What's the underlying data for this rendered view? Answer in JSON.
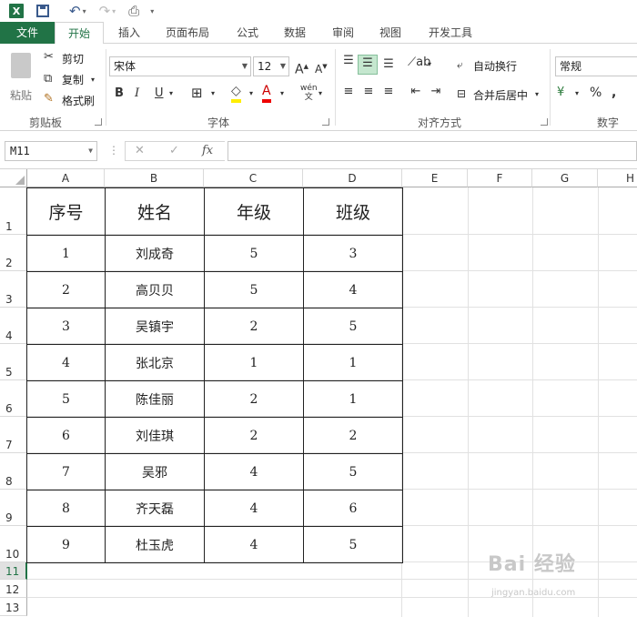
{
  "qat": {
    "excel_logo": "X",
    "icons": [
      "excel-icon",
      "save-icon",
      "undo-icon",
      "redo-icon",
      "print-preview-icon",
      "customize-icon"
    ]
  },
  "tabs": [
    "文件",
    "开始",
    "插入",
    "页面布局",
    "公式",
    "数据",
    "审阅",
    "视图",
    "开发工具"
  ],
  "ribbon": {
    "clipboard": {
      "paste": "粘贴",
      "cut": "剪切",
      "copy": "复制",
      "format_painter": "格式刷",
      "label": "剪贴板"
    },
    "font": {
      "name": "宋体",
      "size": "12",
      "bold": "B",
      "italic": "I",
      "underline": "U",
      "label": "字体"
    },
    "alignment": {
      "wrap": "自动换行",
      "merge": "合并后居中",
      "label": "对齐方式"
    },
    "number": {
      "format": "常规",
      "label": "数字"
    }
  },
  "formula_bar": {
    "name_box": "M11",
    "cancel": "✕",
    "enter": "✓",
    "fx": "fx",
    "value": ""
  },
  "columns": [
    "A",
    "B",
    "C",
    "D",
    "E",
    "F",
    "G",
    "H"
  ],
  "rows": [
    "1",
    "2",
    "3",
    "4",
    "5",
    "6",
    "7",
    "8",
    "9",
    "10",
    "11",
    "12",
    "13"
  ],
  "active_row": "11",
  "table": {
    "headers": [
      "序号",
      "姓名",
      "年级",
      "班级"
    ],
    "rows": [
      [
        "1",
        "刘成奇",
        "5",
        "3"
      ],
      [
        "2",
        "高贝贝",
        "5",
        "4"
      ],
      [
        "3",
        "吴镇宇",
        "2",
        "5"
      ],
      [
        "4",
        "张北京",
        "1",
        "1"
      ],
      [
        "5",
        "陈佳丽",
        "2",
        "1"
      ],
      [
        "6",
        "刘佳琪",
        "2",
        "2"
      ],
      [
        "7",
        "吴邪",
        "4",
        "5"
      ],
      [
        "8",
        "齐天磊",
        "4",
        "6"
      ],
      [
        "9",
        "杜玉虎",
        "4",
        "5"
      ]
    ]
  },
  "watermark": {
    "text": "Bai 经验",
    "sub": "jingyan.baidu.com"
  }
}
